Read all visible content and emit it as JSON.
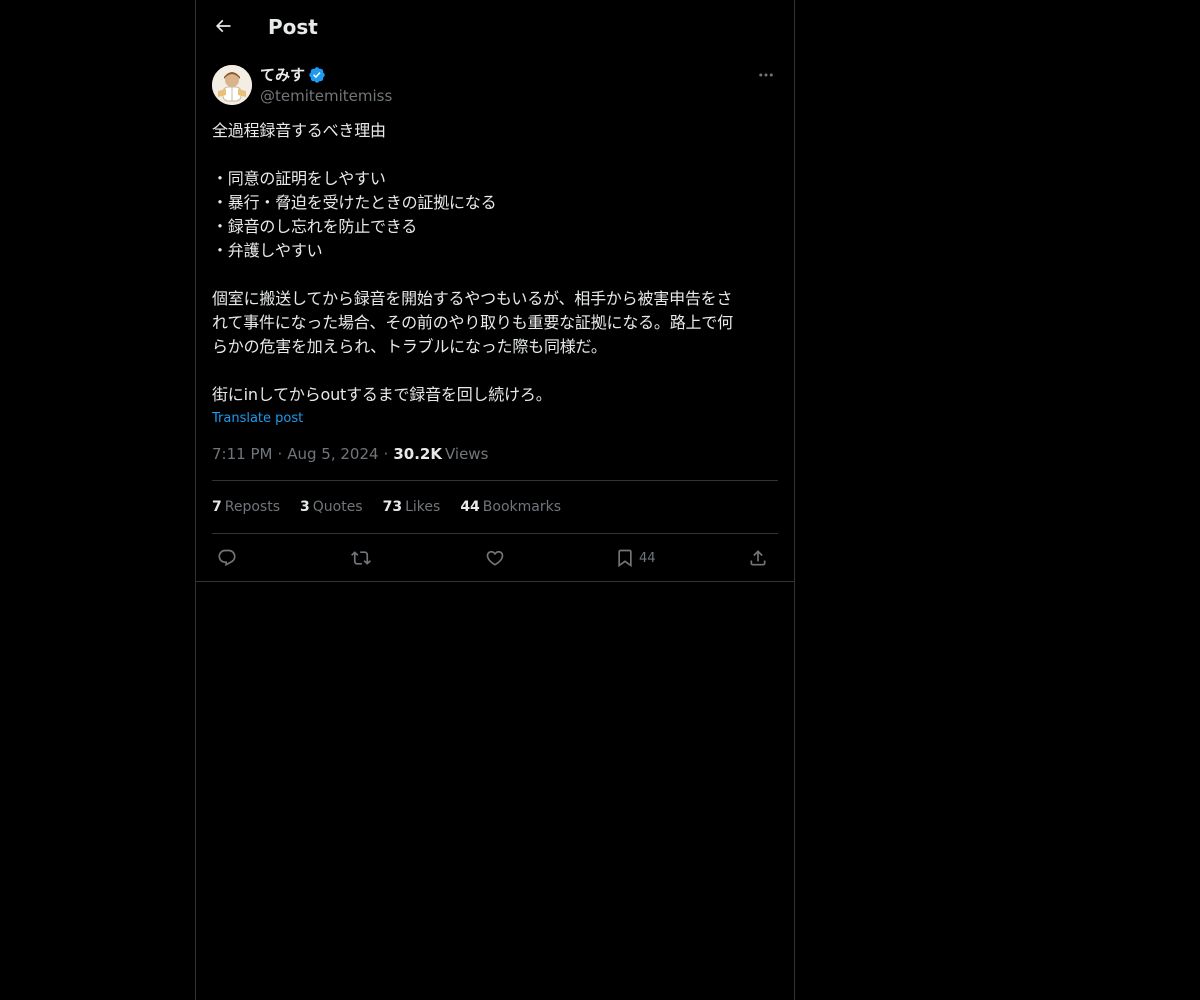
{
  "header": {
    "title": "Post"
  },
  "author": {
    "display_name": "てみす",
    "handle": "@temitemitemiss",
    "verified": true
  },
  "post": {
    "lines": [
      "全過程録音するべき理由",
      "",
      "・同意の証明をしやすい",
      "・暴行・脅迫を受けたときの証拠になる",
      "・録音のし忘れを防止できる",
      "・弁護しやすい",
      "",
      "個室に搬送してから録音を開始するやつもいるが、相手から被害申告をさ",
      "れて事件になった場合、その前のやり取りも重要な証拠になる。路上で何",
      "らかの危害を加えられ、トラブルになった際も同様だ。",
      "",
      "街にinしてからoutするまで録音を回し続けろ。"
    ],
    "translate_label": "Translate post",
    "time": "7:11 PM",
    "date": "Aug 5, 2024",
    "separator": "·",
    "views_count": "30.2K",
    "views_label": "Views"
  },
  "stats": {
    "reposts": {
      "count": "7",
      "label": "Reposts"
    },
    "quotes": {
      "count": "3",
      "label": "Quotes"
    },
    "likes": {
      "count": "73",
      "label": "Likes"
    },
    "bookmarks": {
      "count": "44",
      "label": "Bookmarks"
    }
  },
  "actions": {
    "reply_icon": "reply-icon",
    "repost_icon": "repost-icon",
    "like_icon": "heart-icon",
    "bookmark_icon": "bookmark-icon",
    "bookmark_count": "44",
    "share_icon": "share-icon"
  },
  "colors": {
    "background": "#000000",
    "text": "#e7e9ea",
    "muted": "#71767b",
    "accent": "#1d9bf0",
    "border": "#2f3336"
  }
}
